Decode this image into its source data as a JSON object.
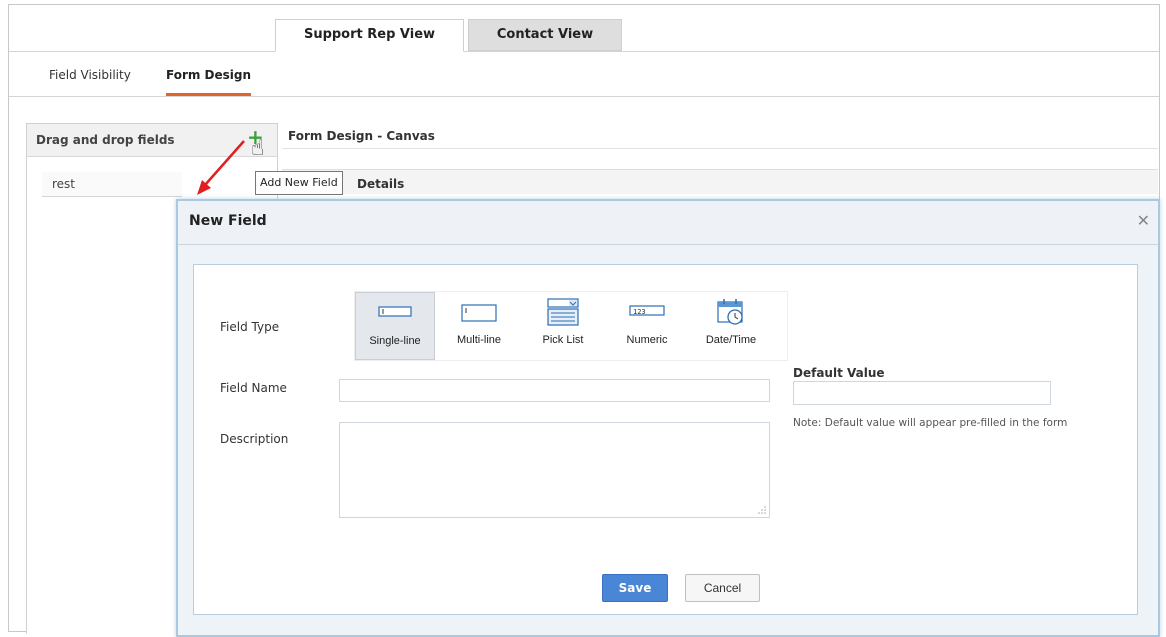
{
  "view_tabs": [
    {
      "label": "Support Rep View",
      "active": true
    },
    {
      "label": "Contact View",
      "active": false
    }
  ],
  "sub_tabs": [
    {
      "label": "Field Visibility",
      "active": false
    },
    {
      "label": "Form Design",
      "active": true
    }
  ],
  "left_panel": {
    "title": "Drag and drop fields",
    "items": [
      "rest"
    ],
    "add_icon": "plus-icon",
    "cursor_icon": "hand-pointer-icon"
  },
  "canvas": {
    "title": "Form Design - Canvas",
    "section_label": "Details"
  },
  "tooltip": "Add New Field",
  "modal": {
    "title": "New Field",
    "close_icon": "close-icon",
    "field_type_label": "Field Type",
    "field_types": [
      {
        "label": "Single-line",
        "icon": "single-line-icon",
        "selected": true
      },
      {
        "label": "Multi-line",
        "icon": "multi-line-icon",
        "selected": false
      },
      {
        "label": "Pick List",
        "icon": "pick-list-icon",
        "selected": false
      },
      {
        "label": "Numeric",
        "icon": "numeric-icon",
        "selected": false
      },
      {
        "label": "Date/Time",
        "icon": "date-time-icon",
        "selected": false
      }
    ],
    "numeric_icon_text": "123",
    "field_name_label": "Field Name",
    "field_name_value": "",
    "description_label": "Description",
    "description_value": "",
    "default_value_label": "Default Value",
    "default_value_value": "",
    "note": "Note: Default value will appear pre-filled in the form",
    "save_label": "Save",
    "cancel_label": "Cancel"
  },
  "colors": {
    "accent_orange": "#e0642b",
    "save_blue": "#4a86d6",
    "add_green": "#3da23d",
    "arrow_red": "#e02020",
    "modal_border": "#a9c8e1"
  }
}
